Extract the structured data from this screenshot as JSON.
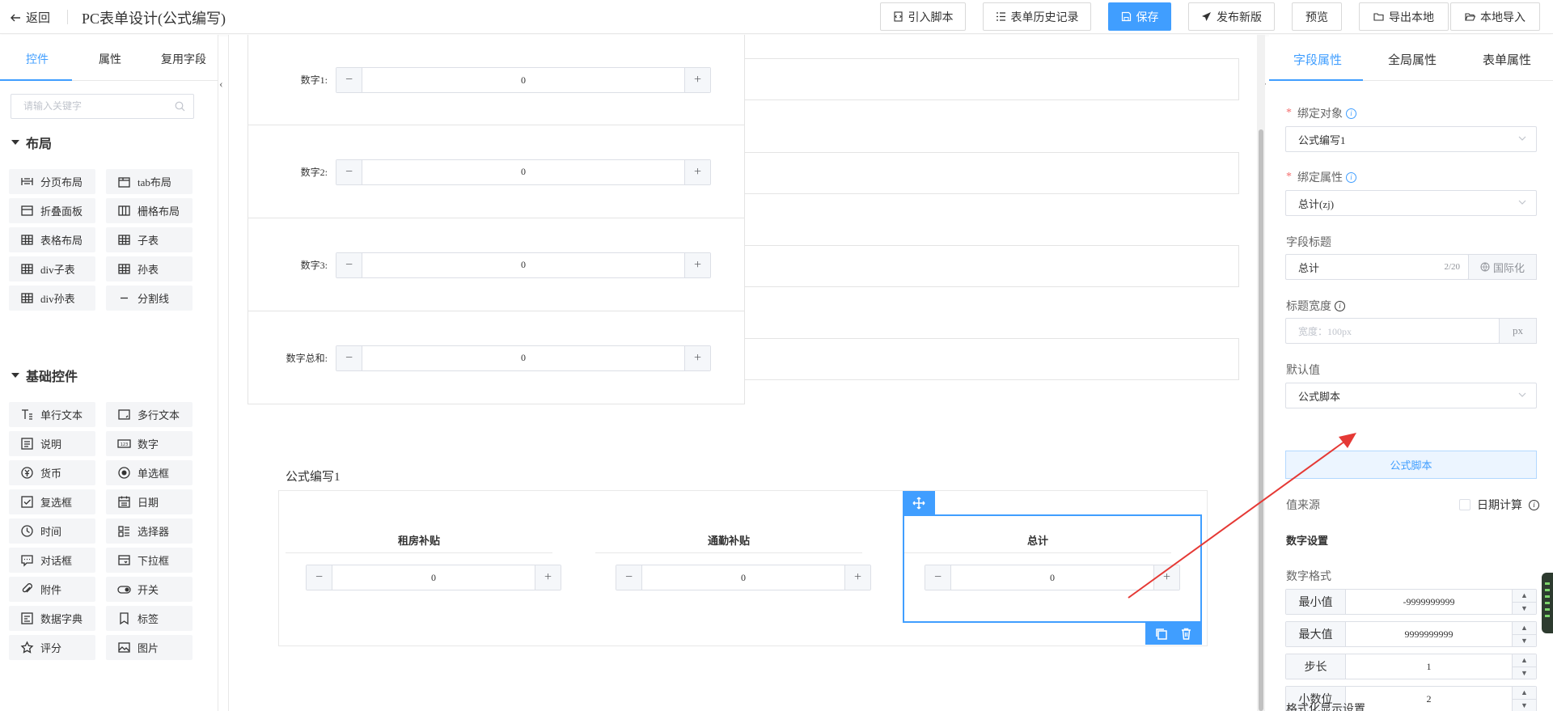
{
  "header": {
    "back_label": "返回",
    "title": "PC表单设计(公式编写)",
    "buttons": {
      "import_script": "引入脚本",
      "history": "表单历史记录",
      "save": "保存",
      "publish": "发布新版",
      "preview": "预览",
      "export": "导出本地",
      "import_local": "本地导入"
    }
  },
  "left": {
    "tabs": [
      "控件",
      "属性",
      "复用字段"
    ],
    "search_placeholder": "请输入关键字",
    "layout_section": "布局",
    "layout_items": [
      "分页布局",
      "tab布局",
      "折叠面板",
      "栅格布局",
      "表格布局",
      "子表",
      "div子表",
      "孙表",
      "div孙表",
      "分割线"
    ],
    "basic_section": "基础控件",
    "basic_items": [
      "单行文本",
      "多行文本",
      "说明",
      "数字",
      "货币",
      "单选框",
      "复选框",
      "日期",
      "时间",
      "选择器",
      "对话框",
      "下拉框",
      "附件",
      "开关",
      "数据字典",
      "标签",
      "评分",
      "图片"
    ]
  },
  "canvas": {
    "rows": [
      {
        "label": "数字1:",
        "value": "0"
      },
      {
        "label": "数字2:",
        "value": "0"
      },
      {
        "label": "数字3:",
        "value": "0"
      },
      {
        "label": "数字总和:",
        "value": "0"
      }
    ],
    "stepper_minus": "−",
    "stepper_plus": "+",
    "formula_title": "公式编写1",
    "columns": [
      {
        "header": "租房补贴",
        "value": "0"
      },
      {
        "header": "通勤补贴",
        "value": "0"
      },
      {
        "header": "总计",
        "value": "0"
      }
    ]
  },
  "right": {
    "tabs": [
      "字段属性",
      "全局属性",
      "表单属性"
    ],
    "bind_object_label": "绑定对象",
    "bind_object_value": "公式编写1",
    "bind_attr_label": "绑定属性",
    "bind_attr_value": "总计(zj)",
    "field_title_label": "字段标题",
    "field_title_value": "总计",
    "field_title_counter": "2/20",
    "i18n_label": "国际化",
    "title_width_label": "标题宽度",
    "title_width_placeholder": "宽度：100px",
    "title_width_unit": "px",
    "default_label": "默认值",
    "default_value": "公式脚本",
    "formula_button": "公式脚本",
    "value_source_label": "值来源",
    "date_calc_label": "日期计算",
    "number_settings": "数字设置",
    "number_format": "数字格式",
    "number_rows": [
      {
        "label": "最小值",
        "value": "-9999999999"
      },
      {
        "label": "最大值",
        "value": "9999999999"
      },
      {
        "label": "步长",
        "value": "1"
      },
      {
        "label": "小数位",
        "value": "2"
      }
    ],
    "format_display": "格式化显示设置"
  },
  "colors": {
    "accent": "#409eff",
    "annotation": "#e53935"
  }
}
